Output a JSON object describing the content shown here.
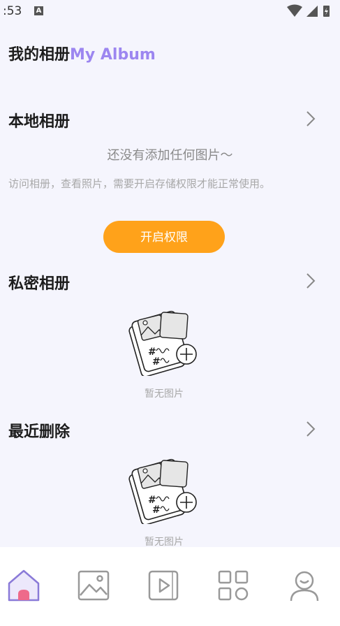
{
  "status_bar": {
    "time": ":53",
    "notification_letter": "A"
  },
  "header": {
    "title_cn": "我的相册",
    "title_en": "My Album"
  },
  "local_album": {
    "title": "本地相册",
    "empty_title": "还没有添加任何图片～",
    "empty_desc": "访问相册，查看照片，需要开启存储权限才能正常使用。",
    "button_label": "开启权限"
  },
  "private_album": {
    "title": "私密相册",
    "empty_caption": "暂无图片"
  },
  "recently_deleted": {
    "title": "最近删除",
    "empty_caption": "暂无图片"
  },
  "tab_bar": {
    "tabs": [
      {
        "icon": "home-icon",
        "active": true
      },
      {
        "icon": "image-icon",
        "active": false
      },
      {
        "icon": "video-icon",
        "active": false
      },
      {
        "icon": "apps-icon",
        "active": false
      },
      {
        "icon": "profile-icon",
        "active": false
      }
    ]
  },
  "colors": {
    "accent_purple": "#9c86f0",
    "button_orange": "#ffa21a",
    "background": "#f5f5fd"
  }
}
